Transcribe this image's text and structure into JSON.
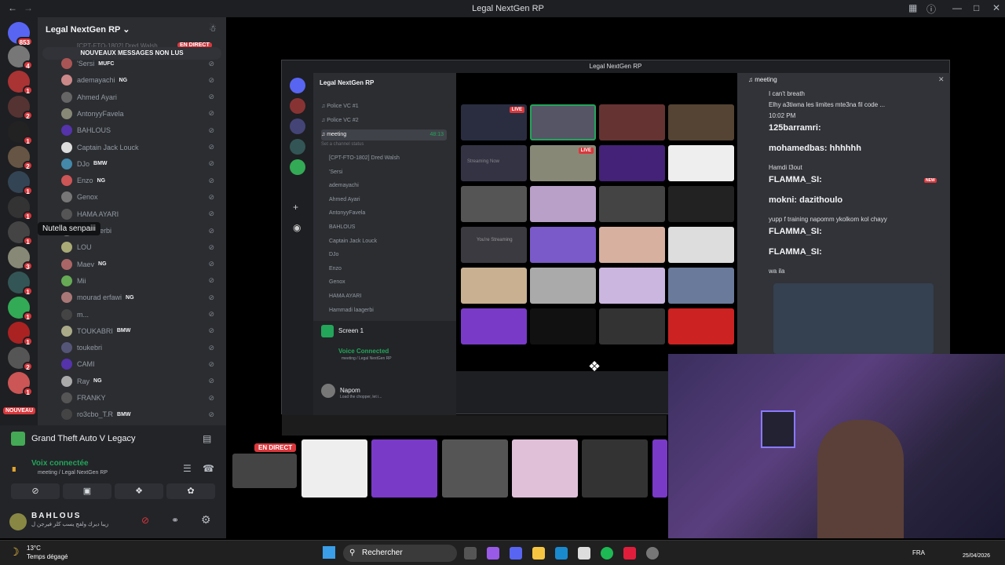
{
  "window": {
    "title": "Legal NextGen RP"
  },
  "rail": {
    "badges": [
      "853",
      "4",
      "1",
      "2",
      "1",
      "2",
      "1",
      "1",
      "1",
      "1",
      "3",
      "1",
      "1",
      "1",
      "2",
      "1",
      "1"
    ],
    "new_label": "NOUVEAU"
  },
  "sidebar": {
    "server_name": "Legal NextGen RP",
    "unread_banner": "NOUVEAUX MESSAGES NON LUS",
    "top_partial": "[CPT-FTO-1802] Dred Walsh",
    "en_direct": "EN DIRECT",
    "members": [
      {
        "name": "'Sersi",
        "tag": "MUFC"
      },
      {
        "name": "ademayachi",
        "tag": "NG"
      },
      {
        "name": "Ahmed Ayari",
        "tag": ""
      },
      {
        "name": "AntonyyFavela",
        "tag": ""
      },
      {
        "name": "BAHLOUS",
        "tag": ""
      },
      {
        "name": "Captain Jack Louck",
        "tag": ""
      },
      {
        "name": "DJo",
        "tag": "BMW"
      },
      {
        "name": "Enzo",
        "tag": "NG"
      },
      {
        "name": "Genox",
        "tag": ""
      },
      {
        "name": "HAMA AYARI",
        "tag": ""
      },
      {
        "name": "...i laagerbi",
        "tag": ""
      },
      {
        "name": "LOU",
        "tag": ""
      },
      {
        "name": "Maev",
        "tag": "NG"
      },
      {
        "name": "Mii",
        "tag": ""
      },
      {
        "name": "mourad erfawi",
        "tag": "NG"
      },
      {
        "name": "m...",
        "tag": ""
      },
      {
        "name": "TOUKABRI",
        "tag": "BMW"
      },
      {
        "name": "toukebri",
        "tag": ""
      },
      {
        "name": "CAMI",
        "tag": ""
      },
      {
        "name": "Ray",
        "tag": "NG"
      },
      {
        "name": "FRANKY",
        "tag": ""
      },
      {
        "name": "ro3cbo_T.R",
        "tag": "BMW"
      }
    ]
  },
  "tooltip": "Nutella senpaiii",
  "voice_panel": {
    "game": "Grand Theft Auto V Legacy",
    "status": "Voix connectée",
    "route": "meeting / Legal NextGen RP",
    "username": "BAHLOUS",
    "user_status": "زيبا ديرك ولفج يسب كلز فيرجن ل"
  },
  "inner": {
    "title": "Legal NextGen RP",
    "server_name": "Legal NextGen RP",
    "channels": [
      "Police VC #1",
      "Police VC #2",
      "meeting"
    ],
    "meeting_timer": "48:13",
    "channel_status": "Set a channel status",
    "members": [
      "[CPT-FTO-1802] Dred Walsh",
      "'Sersi",
      "ademayachi",
      "Ahmed Ayari",
      "AntonyyFavela",
      "BAHLOUS",
      "Captain Jack Louck",
      "DJo",
      "Enzo",
      "Genox",
      "HAMA AYARI",
      "Hammadi laagerbi"
    ],
    "live": "LIVE",
    "screen": "Screen 1",
    "voice_connected": "Voice Connected",
    "voice_route": "meeting / Legal NextGen RP",
    "user": "Napom",
    "user_status": "Load the chopper, let i...",
    "streaming_now": "Streaming Now",
    "youre_streaming": "You're Streaming",
    "chat_header": "meeting",
    "chat": [
      {
        "who": "",
        "text": "I can't breath"
      },
      {
        "who": "MUFC",
        "text": "Elhy a3tiwna les limites mte3na fil code ..."
      },
      {
        "who": "@ademayachi",
        "text": "10:02 PM"
      },
      {
        "who": "",
        "text": "125barramri:",
        "big": true
      },
      {
        "who": "",
        "text": "mohamedbas: hhhhhh",
        "big": true
      },
      {
        "who": "",
        "text": "Hamdi l3out"
      },
      {
        "who": "",
        "text": "FLAMMA_SI:",
        "big": true
      },
      {
        "who": "",
        "text": "mokni: dazithoulo",
        "big": true
      },
      {
        "who": "",
        "text": "yupp f training napomm ykolkom kol chayy"
      },
      {
        "who": "",
        "text": "FLAMMA_SI:",
        "big": true
      },
      {
        "who": "",
        "text": "FLAMMA_SI:",
        "big": true
      },
      {
        "who": "",
        "text": "wa ila"
      }
    ],
    "new_badge": "NEW",
    "time": "10:02 PM"
  },
  "strip": {
    "en_direct": "EN DIRECT"
  },
  "taskbar": {
    "temp": "13°C",
    "weather": "Temps dégagé",
    "search": "Rechercher",
    "lang": "FRA",
    "date": "25/04/2026"
  },
  "colors": {
    "discord_dark": "#1e1f22",
    "sidebar": "#2b2d31",
    "green": "#23a55a",
    "red": "#da373c",
    "blurple": "#5865f2"
  }
}
